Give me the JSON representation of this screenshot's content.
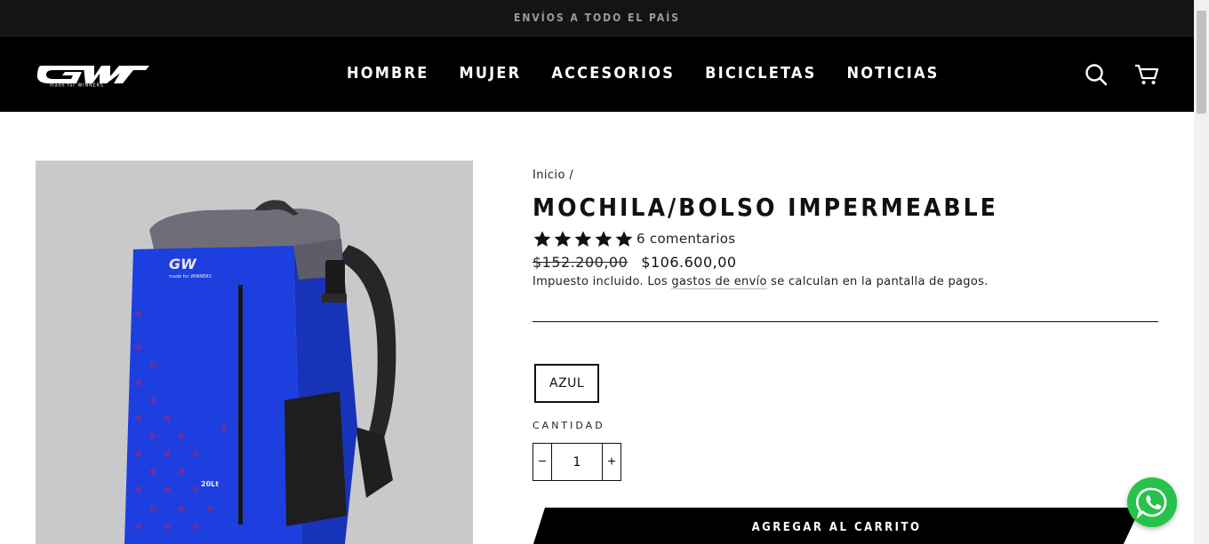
{
  "announcement": "ENVÍOS A TODO EL PAÍS",
  "header": {
    "logo_text": "GW made for WINNERS",
    "nav": [
      "HOMBRE",
      "MUJER",
      "ACCESORIOS",
      "BICICLETAS",
      "NOTICIAS"
    ],
    "icons": [
      "search-icon",
      "cart-icon"
    ]
  },
  "product": {
    "breadcrumb": {
      "home": "Inicio",
      "sep": "/"
    },
    "title": "MOCHILA/BOLSO IMPERMEABLE",
    "rating": {
      "stars": 5,
      "reviews_label": "6 comentarios"
    },
    "old_price": "$152.200,00",
    "price": "$106.600,00",
    "tax_note": {
      "before": "Impuesto incluido. Los ",
      "link": "gastos de envío",
      "after": " se calculan en la pantalla de pagos."
    },
    "variant": "AZUL",
    "quantity_label": "CANTIDAD",
    "quantity": "1",
    "qty_minus": "−",
    "qty_plus": "+",
    "add_to_cart": "AGREGAR AL CARRITO",
    "image_print": {
      "brand": "GW",
      "tagline": "made for WINNERS",
      "capacity": "20Lt"
    }
  },
  "colors": {
    "header_bg": "#000000",
    "backpack_blue": "#1d3fe0",
    "whatsapp": "#27c24b"
  }
}
